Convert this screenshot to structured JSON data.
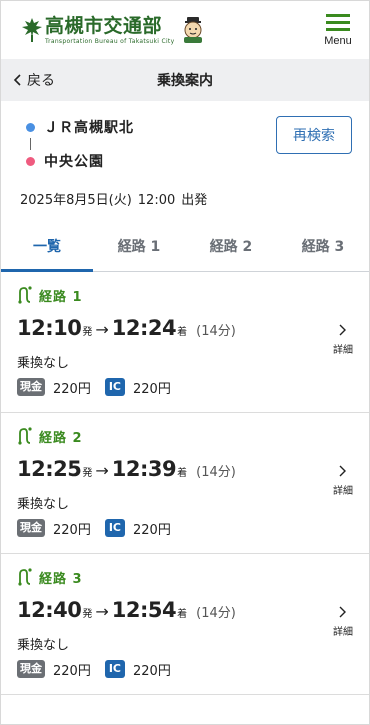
{
  "header": {
    "logo_title": "高槻市交通部",
    "logo_subtitle": "Transportation Bureau of Takatsuki City",
    "menu_label": "Menu"
  },
  "pagebar": {
    "back_label": "戻る",
    "title": "乗換案内"
  },
  "summary": {
    "from": "ＪＲ高槻駅北",
    "to": "中央公園",
    "date": "2025年8月5日(火)",
    "time": "12:00",
    "mode": "出発",
    "research_label": "再検索"
  },
  "tabs": [
    {
      "label": "一覧",
      "active": true
    },
    {
      "label": "経路 1",
      "active": false
    },
    {
      "label": "経路 2",
      "active": false
    },
    {
      "label": "経路 3",
      "active": false
    }
  ],
  "routes": [
    {
      "name": "経路 1",
      "depart": "12:10",
      "depart_suffix": "発",
      "arrow": "→",
      "arrive": "12:24",
      "arrive_suffix": "着",
      "duration": "(14分)",
      "transfer": "乗換なし",
      "cash_label": "現金",
      "cash_fare": "220円",
      "ic_label": "IC",
      "ic_fare": "220円",
      "detail_label": "詳細"
    },
    {
      "name": "経路 2",
      "depart": "12:25",
      "depart_suffix": "発",
      "arrow": "→",
      "arrive": "12:39",
      "arrive_suffix": "着",
      "duration": "(14分)",
      "transfer": "乗換なし",
      "cash_label": "現金",
      "cash_fare": "220円",
      "ic_label": "IC",
      "ic_fare": "220円",
      "detail_label": "詳細"
    },
    {
      "name": "経路 3",
      "depart": "12:40",
      "depart_suffix": "発",
      "arrow": "→",
      "arrive": "12:54",
      "arrive_suffix": "着",
      "duration": "(14分)",
      "transfer": "乗換なし",
      "cash_label": "現金",
      "cash_fare": "220円",
      "ic_label": "IC",
      "ic_fare": "220円",
      "detail_label": "詳細"
    }
  ],
  "colors": {
    "brand_green": "#2a6a2a",
    "route_green": "#3a8a1f",
    "accent_blue": "#1f66ad",
    "origin_dot": "#4a90e2",
    "dest_dot": "#ef5b7f",
    "cash_badge": "#6b6f74"
  }
}
